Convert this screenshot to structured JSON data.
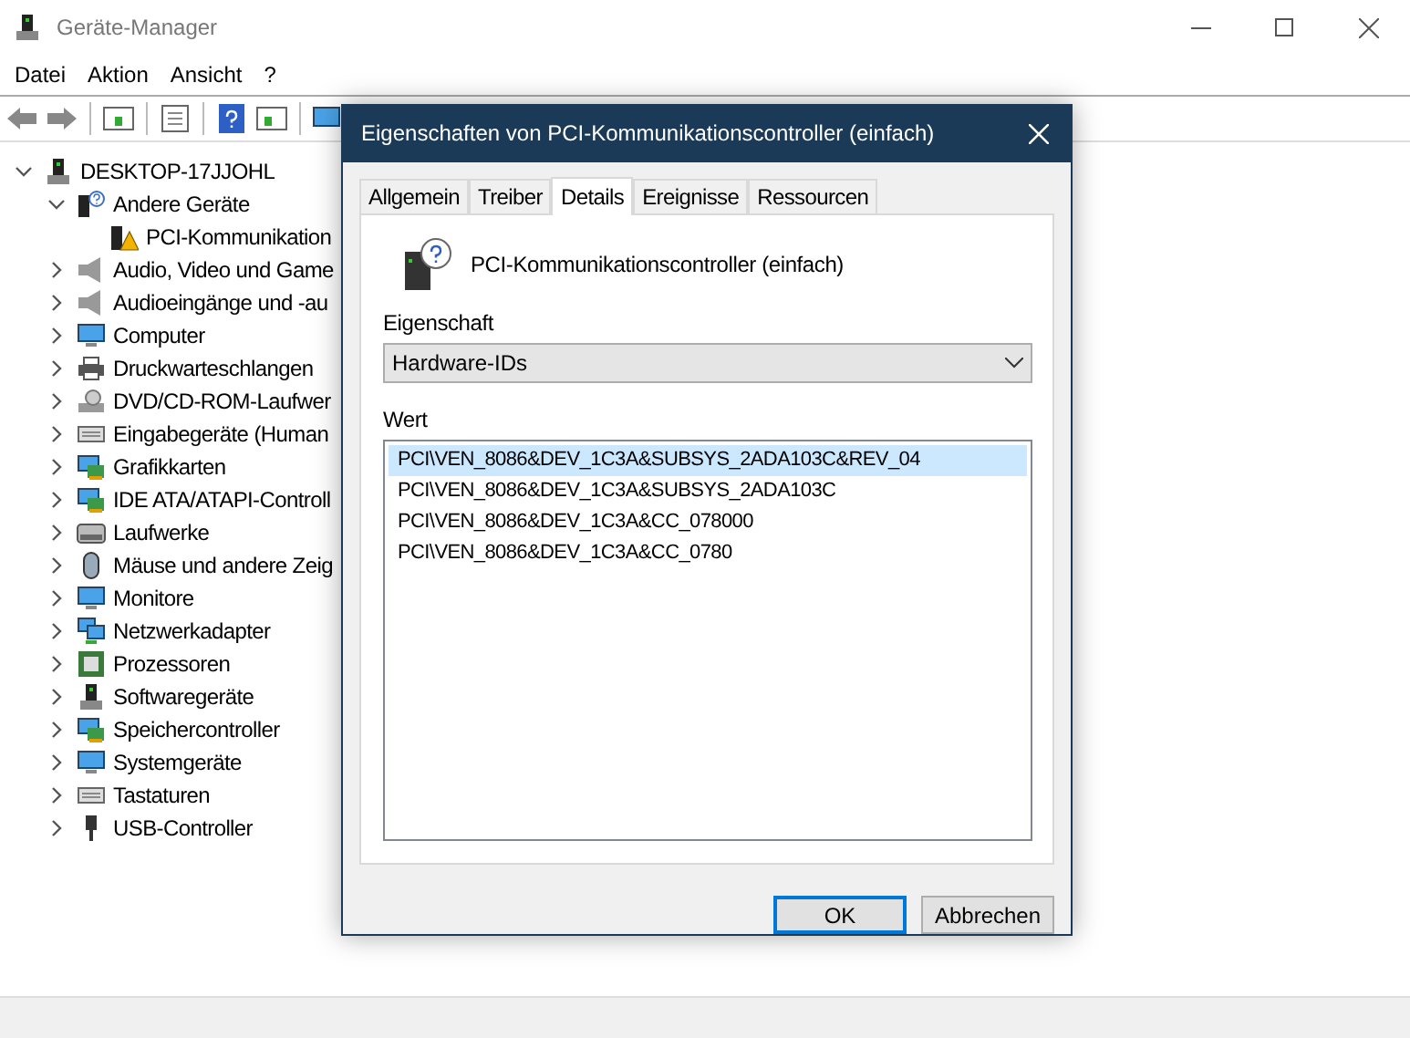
{
  "window": {
    "title": "Geräte-Manager"
  },
  "menu": [
    "Datei",
    "Aktion",
    "Ansicht",
    "?"
  ],
  "tree": [
    {
      "label": "DESKTOP-17JJOHL",
      "expanded": true,
      "children": [
        {
          "label": "Andere Geräte",
          "expanded": true,
          "children": [
            {
              "label": "PCI-Kommunikation"
            }
          ]
        },
        {
          "label": "Audio, Video und Game",
          "expanded": false
        },
        {
          "label": "Audioeingänge und -au",
          "expanded": false
        },
        {
          "label": "Computer",
          "expanded": false
        },
        {
          "label": "Druckwarteschlangen",
          "expanded": false
        },
        {
          "label": "DVD/CD-ROM-Laufwer",
          "expanded": false
        },
        {
          "label": "Eingabegeräte (Human",
          "expanded": false
        },
        {
          "label": "Grafikkarten",
          "expanded": false
        },
        {
          "label": "IDE ATA/ATAPI-Controll",
          "expanded": false
        },
        {
          "label": "Laufwerke",
          "expanded": false
        },
        {
          "label": "Mäuse und andere Zeig",
          "expanded": false
        },
        {
          "label": "Monitore",
          "expanded": false
        },
        {
          "label": "Netzwerkadapter",
          "expanded": false
        },
        {
          "label": "Prozessoren",
          "expanded": false
        },
        {
          "label": "Softwaregeräte",
          "expanded": false
        },
        {
          "label": "Speichercontroller",
          "expanded": false
        },
        {
          "label": "Systemgeräte",
          "expanded": false
        },
        {
          "label": "Tastaturen",
          "expanded": false
        },
        {
          "label": "USB-Controller",
          "expanded": false
        }
      ]
    }
  ],
  "dialog": {
    "title": "Eigenschaften von PCI-Kommunikationscontroller (einfach)",
    "tabs": [
      {
        "label": "Allgemein",
        "selected": false
      },
      {
        "label": "Treiber",
        "selected": false
      },
      {
        "label": "Details",
        "selected": true
      },
      {
        "label": "Ereignisse",
        "selected": false
      },
      {
        "label": "Ressourcen",
        "selected": false
      }
    ],
    "device_name": "PCI-Kommunikationscontroller (einfach)",
    "property_label": "Eigenschaft",
    "property_value": "Hardware-IDs",
    "value_label": "Wert",
    "values": [
      {
        "text": "PCI\\VEN_8086&DEV_1C3A&SUBSYS_2ADA103C&REV_04",
        "selected": true
      },
      {
        "text": "PCI\\VEN_8086&DEV_1C3A&SUBSYS_2ADA103C",
        "selected": false
      },
      {
        "text": "PCI\\VEN_8086&DEV_1C3A&CC_078000",
        "selected": false
      },
      {
        "text": "PCI\\VEN_8086&DEV_1C3A&CC_0780",
        "selected": false
      }
    ],
    "buttons": [
      {
        "label": "OK",
        "default": true
      },
      {
        "label": "Abbrechen",
        "default": false
      }
    ]
  }
}
